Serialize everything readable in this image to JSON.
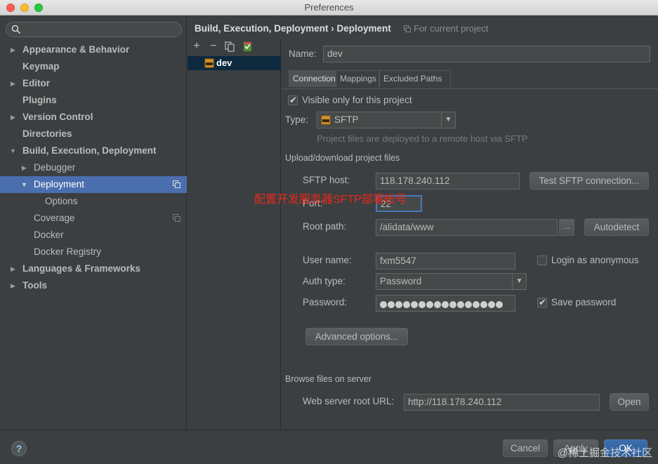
{
  "window": {
    "title": "Preferences"
  },
  "search": {
    "placeholder": ""
  },
  "sidebar": {
    "items": [
      {
        "label": "Appearance & Behavior"
      },
      {
        "label": "Keymap"
      },
      {
        "label": "Editor"
      },
      {
        "label": "Plugins"
      },
      {
        "label": "Version Control"
      },
      {
        "label": "Directories"
      },
      {
        "label": "Build, Execution, Deployment"
      },
      {
        "label": "Debugger"
      },
      {
        "label": "Deployment"
      },
      {
        "label": "Options"
      },
      {
        "label": "Coverage"
      },
      {
        "label": "Docker"
      },
      {
        "label": "Docker Registry"
      },
      {
        "label": "Languages & Frameworks"
      },
      {
        "label": "Tools"
      }
    ]
  },
  "header": {
    "breadcrumb": "Build, Execution, Deployment › Deployment",
    "scope": "For current project"
  },
  "servers": {
    "toolbar": {
      "add": "+",
      "remove": "−"
    },
    "items": [
      {
        "label": "dev"
      }
    ]
  },
  "form": {
    "name_label": "Name:",
    "name_value": "dev",
    "tabs": [
      "Connection",
      "Mappings",
      "Excluded Paths"
    ],
    "visible_label": "Visible only for this project",
    "type_label": "Type:",
    "type_value": "SFTP",
    "type_hint": "Project files are deployed to a remote host via SFTP",
    "upload_section": "Upload/download project files",
    "host_label": "SFTP host:",
    "host_value": "118.178.240.112",
    "test_button": "Test SFTP connection...",
    "port_label": "Port:",
    "port_value": "22",
    "root_label": "Root path:",
    "root_value": "/alidata/www",
    "browse_button": "...",
    "autodetect_button": "Autodetect",
    "user_label": "User name:",
    "user_value": "fxm5547",
    "anon_label": "Login as anonymous",
    "auth_label": "Auth type:",
    "auth_value": "Password",
    "password_label": "Password:",
    "password_dots": 16,
    "save_pw_label": "Save password",
    "advanced_button": "Advanced options...",
    "browse_section": "Browse files on server",
    "url_label": "Web server root URL:",
    "url_value": "http://118.178.240.112",
    "open_button": "Open"
  },
  "annotation": "配置开发服务器SFTP部署帐号",
  "footer": {
    "help": "?",
    "cancel": "Cancel",
    "apply": "Apply",
    "ok": "OK",
    "watermark": "@稀土掘金技术社区"
  }
}
